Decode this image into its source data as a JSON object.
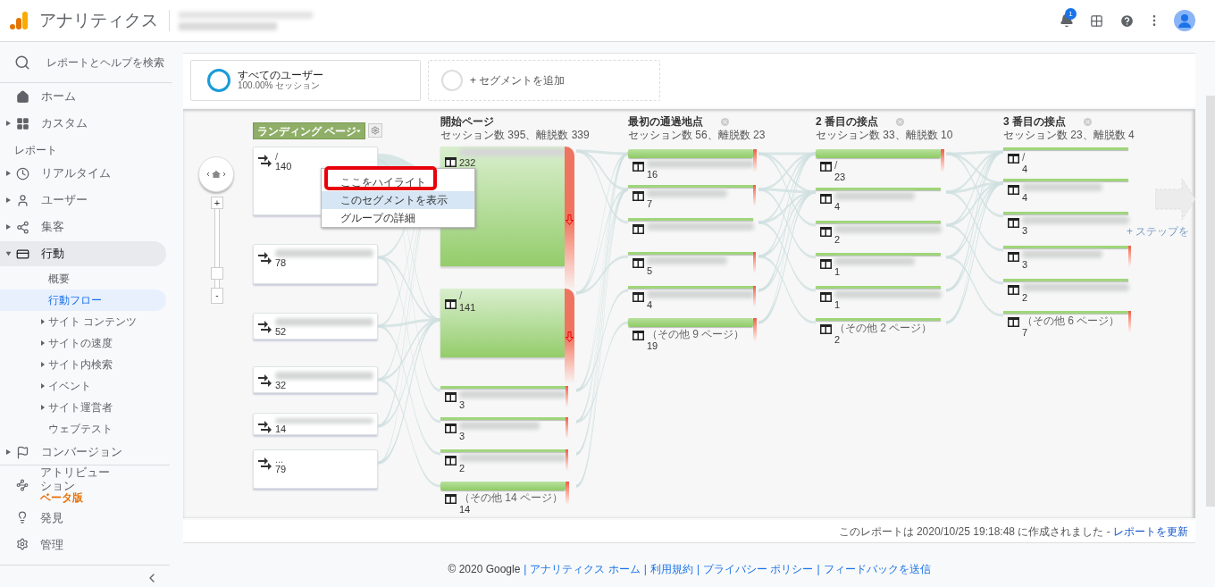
{
  "header": {
    "title": "アナリティクス",
    "notification_count": "1"
  },
  "sidebar": {
    "search_placeholder": "レポートとヘルプを検索",
    "top_items": [
      {
        "label": "ホーム",
        "expandable": false
      },
      {
        "label": "カスタム",
        "expandable": true
      }
    ],
    "section_label": "レポート",
    "report_items": [
      {
        "label": "リアルタイム",
        "expanded": false,
        "selected": false
      },
      {
        "label": "ユーザー",
        "expanded": false,
        "selected": false
      },
      {
        "label": "集客",
        "expanded": false,
        "selected": false
      },
      {
        "label": "行動",
        "expanded": true,
        "selected": true,
        "children": [
          {
            "label": "概要",
            "expandable": false,
            "selected": false
          },
          {
            "label": "行動フロー",
            "expandable": false,
            "selected": true
          },
          {
            "label": "サイト コンテンツ",
            "expandable": true,
            "selected": false
          },
          {
            "label": "サイトの速度",
            "expandable": true,
            "selected": false
          },
          {
            "label": "サイト内検索",
            "expandable": true,
            "selected": false
          },
          {
            "label": "イベント",
            "expandable": true,
            "selected": false
          },
          {
            "label": "サイト運営者",
            "expandable": true,
            "selected": false
          },
          {
            "label": "ウェブテスト",
            "expandable": false,
            "selected": false
          }
        ]
      },
      {
        "label": "コンバージョン",
        "expanded": false,
        "selected": false
      }
    ],
    "bottom_items": [
      {
        "label": "アトリビューション",
        "badge": "ベータ版"
      },
      {
        "label": "発見"
      },
      {
        "label": "管理"
      }
    ]
  },
  "segments": [
    {
      "name": "すべてのユーザー",
      "detail": "100.00% セッション"
    }
  ],
  "add_segment": "+ セグメントを追加",
  "flow": {
    "zoom": {
      "in": "+",
      "out": "-",
      "level": 0.1
    },
    "landing": {
      "dimension": "ランディング ページ",
      "nodes": [
        {
          "label": "/",
          "count": "140",
          "redacted": false
        },
        {
          "count": "78",
          "redacted": true
        },
        {
          "count": "52",
          "redacted": true
        },
        {
          "count": "32",
          "redacted": true
        },
        {
          "count": "14",
          "redacted": true
        },
        {
          "label": "...",
          "count": "79",
          "redacted": false
        }
      ]
    },
    "steps": [
      {
        "title": "開始ページ",
        "stats": "セッション数 395、離脱数 339",
        "removable": false,
        "nodes": [
          {
            "kind": "block",
            "count": "232",
            "redacted": true,
            "exit": true
          },
          {
            "kind": "block",
            "label": "/",
            "count": "141",
            "redacted": false,
            "exit": true
          },
          {
            "kind": "thin",
            "count": "3",
            "redacted": true,
            "exit": true
          },
          {
            "kind": "thin",
            "count": "3",
            "redacted": true,
            "exit": true
          },
          {
            "kind": "thin",
            "count": "2",
            "redacted": true,
            "exit": true
          },
          {
            "kind": "thick",
            "label": "（その他 14 ページ）",
            "count": "14",
            "redacted": false,
            "exit": true
          }
        ]
      },
      {
        "title": "最初の通過地点",
        "stats": "セッション数 56、離脱数 23",
        "removable": true,
        "nodes": [
          {
            "kind": "thick",
            "count": "16",
            "redacted": true,
            "exit": true
          },
          {
            "kind": "thin",
            "count": "7",
            "redacted": true,
            "exit": true
          },
          {
            "kind": "thin",
            "redacted": true,
            "exit": false
          },
          {
            "kind": "thin",
            "count": "5",
            "redacted": true,
            "exit": true
          },
          {
            "kind": "thin",
            "count": "4",
            "redacted": true,
            "exit": true
          },
          {
            "kind": "thick",
            "label": "（その他 9 ページ）",
            "count": "19",
            "redacted": false,
            "exit": true
          }
        ]
      },
      {
        "title": "2 番目の接点",
        "stats": "セッション数 33、離脱数 10",
        "removable": true,
        "nodes": [
          {
            "kind": "thick",
            "label": "/",
            "count": "23",
            "redacted": false,
            "exit": true
          },
          {
            "kind": "thin",
            "count": "4",
            "redacted": true,
            "exit": false
          },
          {
            "kind": "thin",
            "count": "2",
            "redacted": true,
            "exit": false
          },
          {
            "kind": "thin",
            "count": "1",
            "redacted": true,
            "exit": false
          },
          {
            "kind": "thin",
            "count": "1",
            "redacted": true,
            "exit": false
          },
          {
            "kind": "thin",
            "label": "（その他 2 ページ）",
            "count": "2",
            "redacted": false,
            "exit": false
          }
        ]
      },
      {
        "title": "3 番目の接点",
        "stats": "セッション数 23、離脱数 4",
        "removable": true,
        "nodes": [
          {
            "kind": "thin",
            "label": "/",
            "count": "4",
            "redacted": false,
            "exit": false
          },
          {
            "kind": "thin",
            "count": "4",
            "redacted": true,
            "exit": false
          },
          {
            "kind": "thin",
            "count": "3",
            "redacted": true,
            "exit": false
          },
          {
            "kind": "thin",
            "count": "3",
            "redacted": true,
            "exit": true
          },
          {
            "kind": "thin",
            "count": "2",
            "redacted": true,
            "exit": false
          },
          {
            "kind": "thin",
            "label": "（その他 6 ページ）",
            "count": "7",
            "redacted": false,
            "exit": true
          }
        ]
      }
    ],
    "add_step": "+ ステップを",
    "context_menu": [
      {
        "label": "ここをハイライト",
        "selected": false,
        "annotated": true
      },
      {
        "label": "このセグメントを表示",
        "selected": true,
        "annotated": false
      },
      {
        "label": "グループの詳細",
        "selected": false,
        "annotated": false
      }
    ]
  },
  "report_note": {
    "text": "このレポートは 2020/10/25 19:18:48 に作成されました - ",
    "link": "レポートを更新"
  },
  "footer": {
    "copyright": "© 2020 Google",
    "separator": "|",
    "links": [
      "アナリティクス ホーム",
      "利用規約",
      "プライバシー ポリシー",
      "フィードバックを送信"
    ]
  }
}
